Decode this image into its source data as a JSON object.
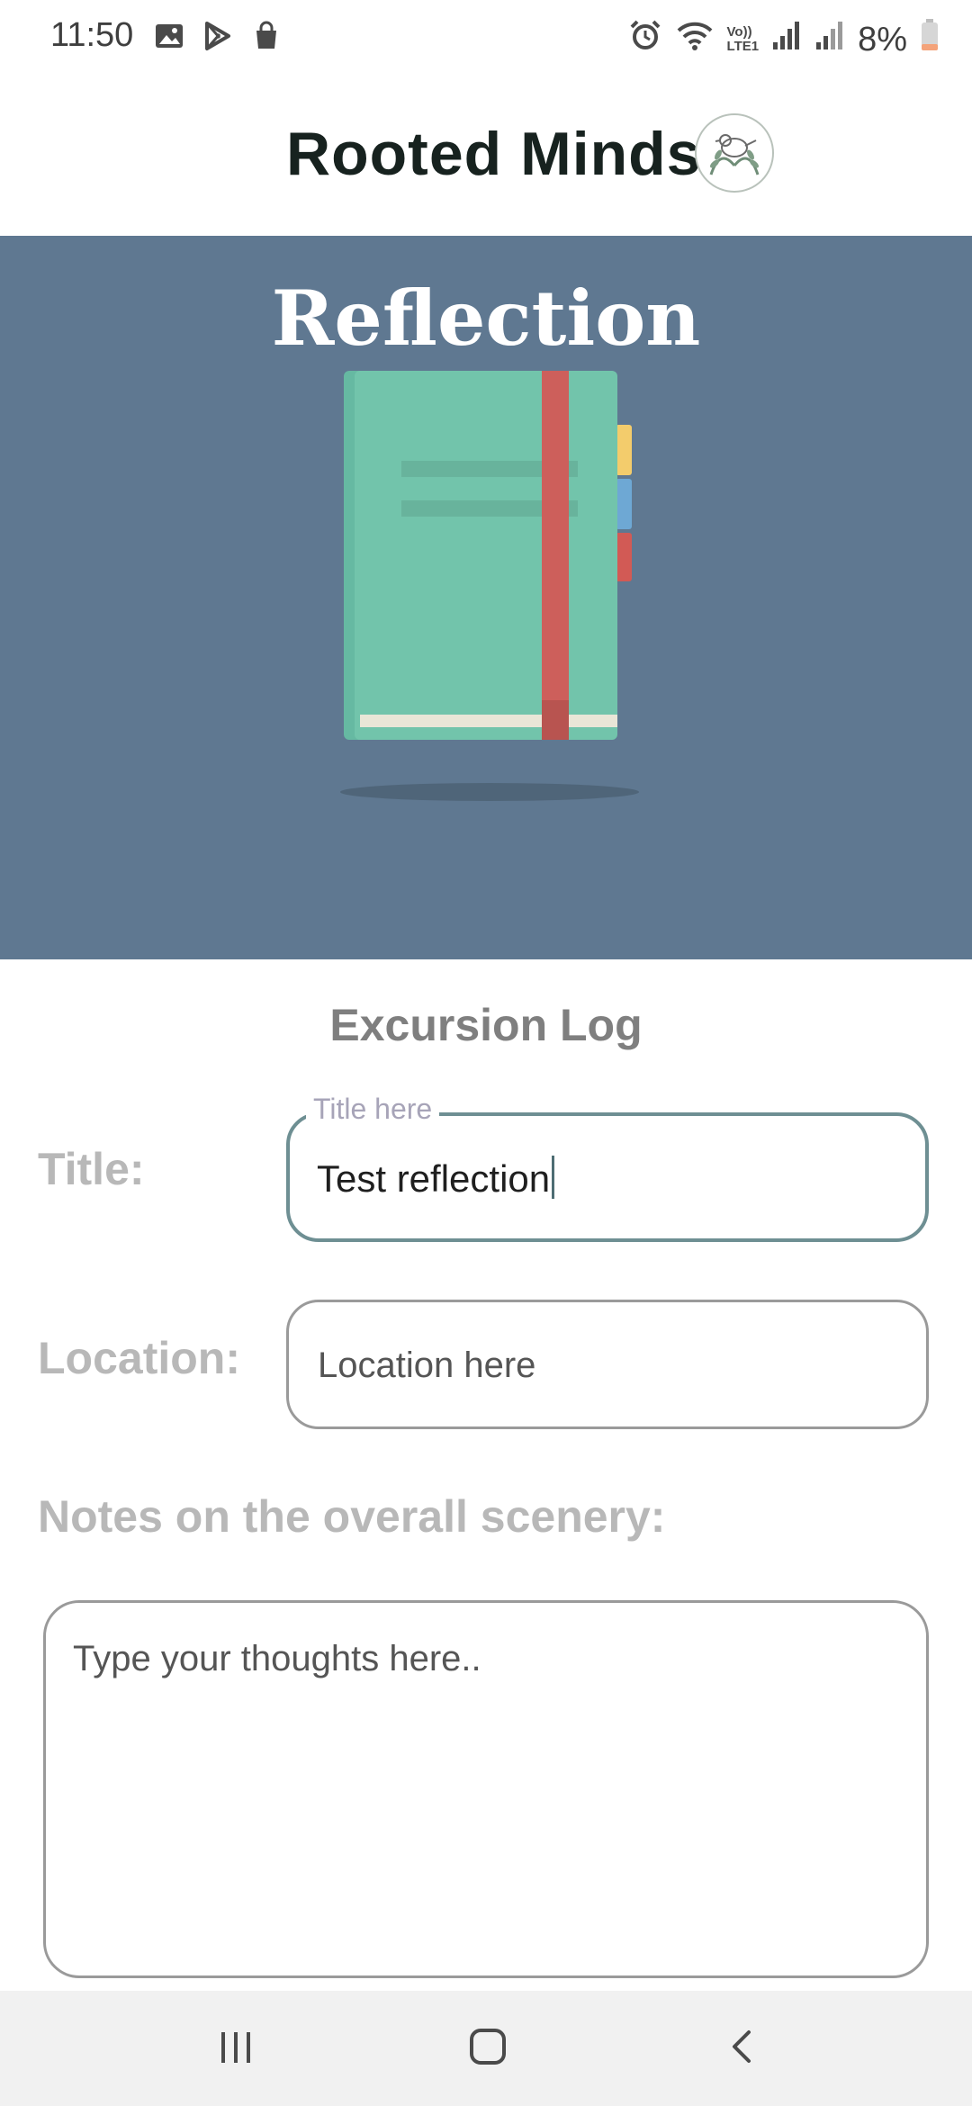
{
  "status_bar": {
    "time": "11:50",
    "battery_percent": "8%",
    "left_icons": [
      "image-icon",
      "play-store-icon",
      "shopping-bag-icon"
    ],
    "right_icons": [
      "alarm-icon",
      "wifi-icon",
      "volte-icon",
      "signal-icon",
      "signal-icon-2",
      "battery-icon"
    ],
    "volte_label_top": "Vo))",
    "volte_label_bottom": "LTE1"
  },
  "header": {
    "app_title": "Rooted Minds",
    "logo_icon": "bird-leaves-logo-icon"
  },
  "hero": {
    "title": "Reflection",
    "background_color": "#5f7891",
    "illustration": "notebook-icon"
  },
  "form": {
    "section_heading": "Excursion Log",
    "title_label": "Title:",
    "title_floating_label": "Title here",
    "title_value": "Test reflection",
    "location_label": "Location:",
    "location_placeholder": "Location here",
    "notes_label": "Notes on the overall scenery:",
    "notes_placeholder": "Type your thoughts here.."
  },
  "colors": {
    "accent_outline": "#6e8f93",
    "label_gray": "#b8b8b8",
    "heading_gray": "#7f7f7f"
  },
  "nav_bar": {
    "buttons": [
      "recent-apps-icon",
      "home-icon",
      "back-icon"
    ]
  }
}
